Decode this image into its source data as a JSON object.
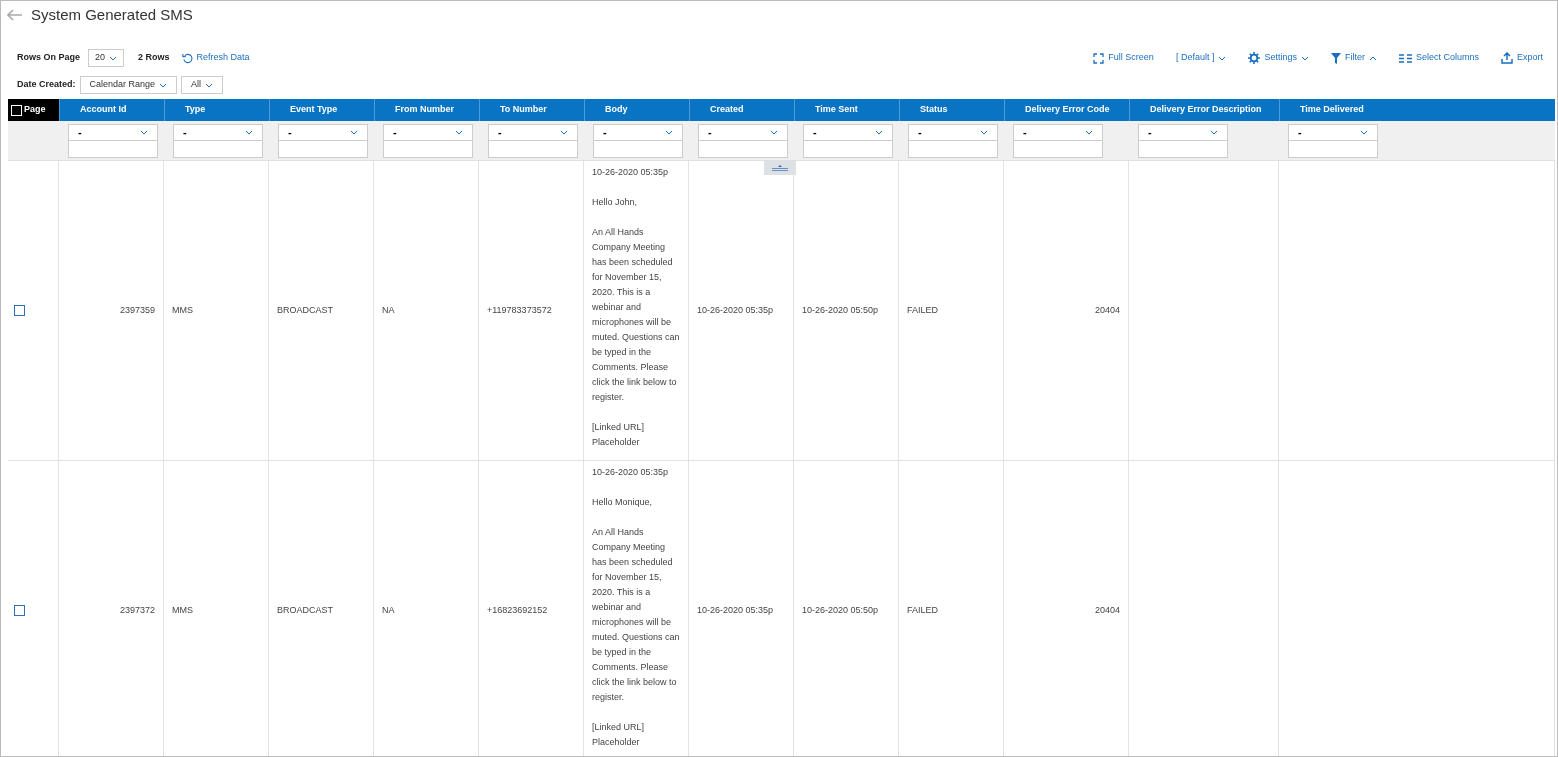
{
  "title": "System Generated SMS",
  "toolbar": {
    "rows_label": "Rows On Page",
    "rows_value": "20",
    "row_count": "2 Rows",
    "refresh": "Refresh Data",
    "date_label": "Date Created:",
    "date_range": "Calendar Range",
    "date_value": "All"
  },
  "actions": [
    {
      "kind": "fullscreen",
      "label": "Full Screen"
    },
    {
      "kind": "view",
      "label": "[ Default ]"
    },
    {
      "kind": "settings",
      "label": "Settings"
    },
    {
      "kind": "filter",
      "label": "Filter"
    },
    {
      "kind": "columns",
      "label": "Select Columns"
    },
    {
      "kind": "export",
      "label": "Export"
    }
  ],
  "table": {
    "select_all": {
      "label": "Page",
      "checked": false
    },
    "columns": [
      {
        "label": "Account Id",
        "filter": "-"
      },
      {
        "label": "Type",
        "filter": "-"
      },
      {
        "label": "Event Type",
        "filter": "-"
      },
      {
        "label": "From Number",
        "filter": "-"
      },
      {
        "label": "To Number",
        "filter": "-"
      },
      {
        "label": "Body",
        "filter": "-"
      },
      {
        "label": "Created",
        "filter": "-"
      },
      {
        "label": "Time Sent",
        "filter": "-"
      },
      {
        "label": "Status",
        "filter": "-"
      },
      {
        "label": "Delivery Error Code",
        "filter": "-"
      },
      {
        "label": "Delivery Error Description",
        "filter": "-"
      },
      {
        "label": "Time Delivered",
        "filter": "-"
      }
    ],
    "rows": [
      {
        "checked": false,
        "cells": [
          "2397359",
          "MMS",
          "BROADCAST",
          "NA",
          "+119783373572",
          [
            "10-26-2020 05:35p",
            "Hello John,",
            "An All Hands Company Meeting has been scheduled for November 15, 2020. This is a webinar and microphones will be muted. Questions can be typed in the Comments. Please click the link below to register.",
            "[Linked URL] Placeholder"
          ],
          "10-26-2020 05:35p",
          "10-26-2020 05:50p",
          "FAILED",
          "20404",
          "",
          ""
        ]
      },
      {
        "checked": false,
        "cells": [
          "2397372",
          "MMS",
          "BROADCAST",
          "NA",
          "+16823692152",
          [
            "10-26-2020 05:35p",
            "Hello Monique,",
            "An All Hands Company Meeting has been scheduled for November 15, 2020. This is a webinar and microphones will be muted. Questions can be typed in the Comments. Please click the link below to register.",
            "[Linked URL] Placeholder"
          ],
          "10-26-2020 05:35p",
          "10-26-2020 05:50p",
          "FAILED",
          "20404",
          "",
          ""
        ]
      }
    ]
  }
}
